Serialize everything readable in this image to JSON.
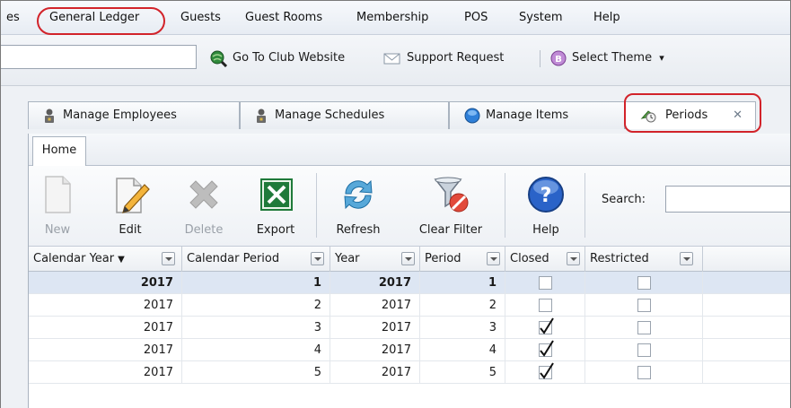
{
  "menubar": {
    "items": [
      {
        "label": "es"
      },
      {
        "label": "General Ledger"
      },
      {
        "label": "Guests"
      },
      {
        "label": "Guest Rooms"
      },
      {
        "label": "Membership"
      },
      {
        "label": "POS"
      },
      {
        "label": "System"
      },
      {
        "label": "Help"
      }
    ]
  },
  "toolbar": {
    "address_value": "",
    "club_website": "Go To Club Website",
    "support_request": "Support Request",
    "select_theme": "Select Theme",
    "select_theme_arrow": "▾"
  },
  "doc_tabs": [
    {
      "label": "Manage Employees",
      "icon": "user-lock-icon"
    },
    {
      "label": "Manage Schedules",
      "icon": "user-lock-icon"
    },
    {
      "label": "Manage Items",
      "icon": "globe-icon"
    },
    {
      "label": "Periods",
      "icon": "periods-icon",
      "close": "✕"
    }
  ],
  "ribbon": {
    "tab": "Home",
    "buttons": {
      "new": "New",
      "edit": "Edit",
      "delete": "Delete",
      "export": "Export",
      "refresh": "Refresh",
      "clear_filter": "Clear Filter",
      "help": "Help"
    },
    "search_label": "Search:",
    "search_value": ""
  },
  "grid": {
    "columns": [
      "Calendar Year",
      "Calendar Period",
      "Year",
      "Period",
      "Closed",
      "Restricted"
    ],
    "sort_indicator": "▼",
    "rows": [
      {
        "calendar_year": "2017",
        "calendar_period": "1",
        "year": "2017",
        "period": "1",
        "closed": false,
        "restricted": false
      },
      {
        "calendar_year": "2017",
        "calendar_period": "2",
        "year": "2017",
        "period": "2",
        "closed": false,
        "restricted": false
      },
      {
        "calendar_year": "2017",
        "calendar_period": "3",
        "year": "2017",
        "period": "3",
        "closed": true,
        "restricted": false
      },
      {
        "calendar_year": "2017",
        "calendar_period": "4",
        "year": "2017",
        "period": "4",
        "closed": true,
        "restricted": false
      },
      {
        "calendar_year": "2017",
        "calendar_period": "5",
        "year": "2017",
        "period": "5",
        "closed": true,
        "restricted": false
      }
    ],
    "selected_row": 0
  },
  "colors": {
    "highlight": "#d2232a",
    "selected_row": "#dde6f3",
    "excel_green": "#1f7a3a",
    "help_blue": "#2a63c8"
  }
}
